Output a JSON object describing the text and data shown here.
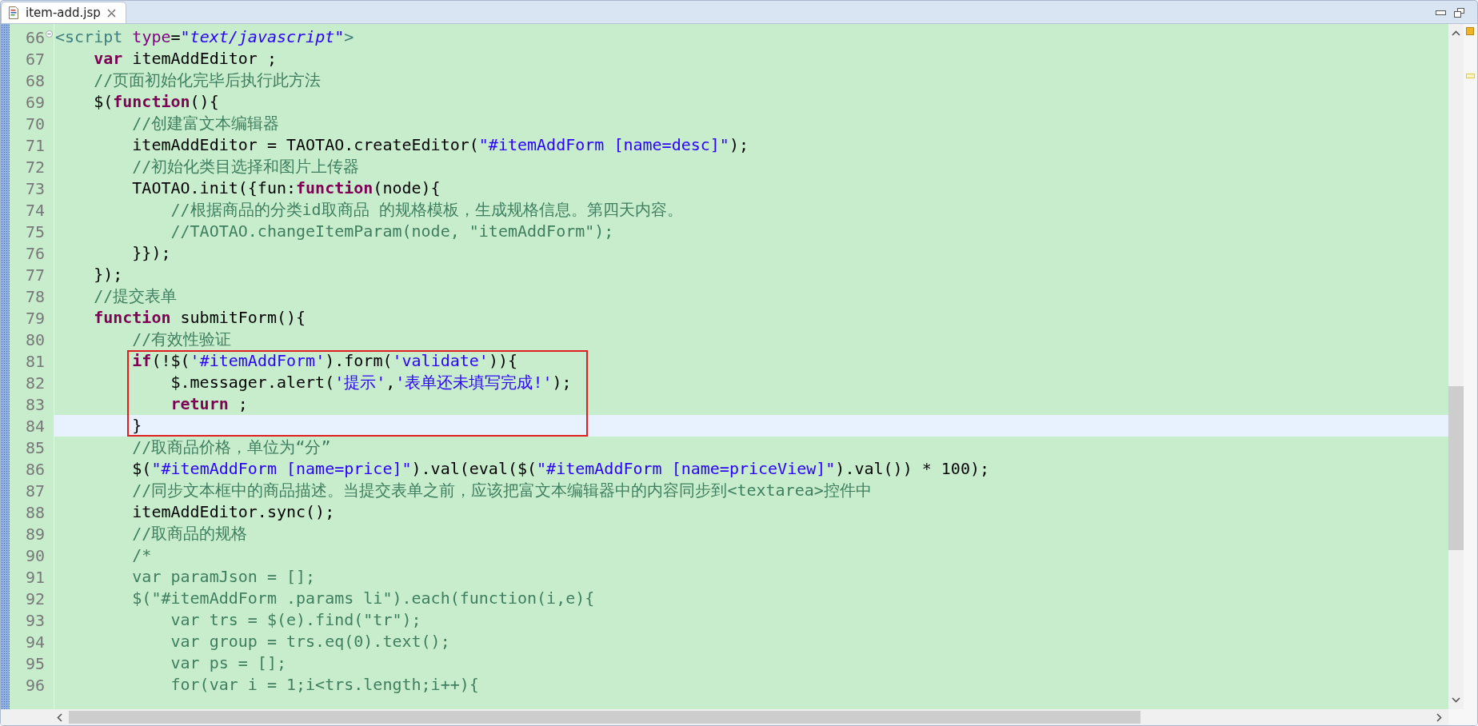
{
  "editor_tab": {
    "title": "item-add.jsp",
    "selected": true
  },
  "lines": [
    {
      "number": "66",
      "fold": true,
      "current": false,
      "boxed": false,
      "tokens": [
        {
          "kind": "tag",
          "text": "<script"
        },
        {
          "kind": "attr",
          "text": " type"
        },
        {
          "kind": "plain",
          "text": "="
        },
        {
          "kind": "attr-value",
          "text": "\"text/javascript\""
        },
        {
          "kind": "tag",
          "text": ">"
        }
      ]
    },
    {
      "number": "67",
      "fold": false,
      "current": false,
      "boxed": false,
      "tokens": [
        {
          "kind": "keyword",
          "text": "    var"
        },
        {
          "kind": "plain",
          "text": " itemAddEditor ;"
        }
      ]
    },
    {
      "number": "68",
      "fold": false,
      "current": false,
      "boxed": false,
      "tokens": [
        {
          "kind": "comment",
          "text": "    //页面初始化完毕后执行此方法"
        }
      ]
    },
    {
      "number": "69",
      "fold": false,
      "current": false,
      "boxed": false,
      "tokens": [
        {
          "kind": "plain",
          "text": "    $("
        },
        {
          "kind": "keyword",
          "text": "function"
        },
        {
          "kind": "plain",
          "text": "(){"
        }
      ]
    },
    {
      "number": "70",
      "fold": false,
      "current": false,
      "boxed": false,
      "tokens": [
        {
          "kind": "comment",
          "text": "        //创建富文本编辑器"
        }
      ]
    },
    {
      "number": "71",
      "fold": false,
      "current": false,
      "boxed": false,
      "tokens": [
        {
          "kind": "plain",
          "text": "        itemAddEditor = TAOTAO.createEditor("
        },
        {
          "kind": "string",
          "text": "\"#itemAddForm [name=desc]\""
        },
        {
          "kind": "plain",
          "text": ");"
        }
      ]
    },
    {
      "number": "72",
      "fold": false,
      "current": false,
      "boxed": false,
      "tokens": [
        {
          "kind": "comment",
          "text": "        //初始化类目选择和图片上传器"
        }
      ]
    },
    {
      "number": "73",
      "fold": false,
      "current": false,
      "boxed": false,
      "tokens": [
        {
          "kind": "plain",
          "text": "        TAOTAO.init({fun:"
        },
        {
          "kind": "keyword",
          "text": "function"
        },
        {
          "kind": "plain",
          "text": "(node){"
        }
      ]
    },
    {
      "number": "74",
      "fold": false,
      "current": false,
      "boxed": false,
      "tokens": [
        {
          "kind": "comment",
          "text": "            //根据商品的分类id取商品 的规格模板，生成规格信息。第四天内容。"
        }
      ]
    },
    {
      "number": "75",
      "fold": false,
      "current": false,
      "boxed": false,
      "tokens": [
        {
          "kind": "comment",
          "text": "            //TAOTAO.changeItemParam(node, \"itemAddForm\");"
        }
      ]
    },
    {
      "number": "76",
      "fold": false,
      "current": false,
      "boxed": false,
      "tokens": [
        {
          "kind": "plain",
          "text": "        }});"
        }
      ]
    },
    {
      "number": "77",
      "fold": false,
      "current": false,
      "boxed": false,
      "tokens": [
        {
          "kind": "plain",
          "text": "    });"
        }
      ]
    },
    {
      "number": "78",
      "fold": false,
      "current": false,
      "boxed": false,
      "tokens": [
        {
          "kind": "comment",
          "text": "    //提交表单"
        }
      ]
    },
    {
      "number": "79",
      "fold": false,
      "current": false,
      "boxed": false,
      "tokens": [
        {
          "kind": "keyword",
          "text": "    function"
        },
        {
          "kind": "plain",
          "text": " submitForm(){"
        }
      ]
    },
    {
      "number": "80",
      "fold": false,
      "current": false,
      "boxed": false,
      "tokens": [
        {
          "kind": "comment",
          "text": "        //有效性验证"
        }
      ]
    },
    {
      "number": "81",
      "fold": false,
      "current": false,
      "boxed": true,
      "tokens": [
        {
          "kind": "keyword",
          "text": "        if"
        },
        {
          "kind": "plain",
          "text": "(!$("
        },
        {
          "kind": "string",
          "text": "'#itemAddForm'"
        },
        {
          "kind": "plain",
          "text": ").form("
        },
        {
          "kind": "string",
          "text": "'validate'"
        },
        {
          "kind": "plain",
          "text": ")){"
        }
      ]
    },
    {
      "number": "82",
      "fold": false,
      "current": false,
      "boxed": true,
      "tokens": [
        {
          "kind": "plain",
          "text": "            $.messager.alert("
        },
        {
          "kind": "string",
          "text": "'提示'"
        },
        {
          "kind": "plain",
          "text": ","
        },
        {
          "kind": "string",
          "text": "'表单还未填写完成!'"
        },
        {
          "kind": "plain",
          "text": ");"
        }
      ]
    },
    {
      "number": "83",
      "fold": false,
      "current": false,
      "boxed": true,
      "tokens": [
        {
          "kind": "keyword",
          "text": "            return"
        },
        {
          "kind": "plain",
          "text": " ;"
        }
      ]
    },
    {
      "number": "84",
      "fold": false,
      "current": true,
      "boxed": true,
      "tokens": [
        {
          "kind": "plain",
          "text": "        }"
        }
      ]
    },
    {
      "number": "85",
      "fold": false,
      "current": false,
      "boxed": false,
      "tokens": [
        {
          "kind": "comment",
          "text": "        //取商品价格，单位为“分”"
        }
      ]
    },
    {
      "number": "86",
      "fold": false,
      "current": false,
      "boxed": false,
      "tokens": [
        {
          "kind": "plain",
          "text": "        $("
        },
        {
          "kind": "string",
          "text": "\"#itemAddForm [name=price]\""
        },
        {
          "kind": "plain",
          "text": ").val(eval($("
        },
        {
          "kind": "string",
          "text": "\"#itemAddForm [name=priceView]\""
        },
        {
          "kind": "plain",
          "text": ").val()) * 100);"
        }
      ]
    },
    {
      "number": "87",
      "fold": false,
      "current": false,
      "boxed": false,
      "tokens": [
        {
          "kind": "comment",
          "text": "        //同步文本框中的商品描述。当提交表单之前，应该把富文本编辑器中的内容同步到<textarea>控件中"
        }
      ]
    },
    {
      "number": "88",
      "fold": false,
      "current": false,
      "boxed": false,
      "tokens": [
        {
          "kind": "plain",
          "text": "        itemAddEditor.sync();"
        }
      ]
    },
    {
      "number": "89",
      "fold": false,
      "current": false,
      "boxed": false,
      "tokens": [
        {
          "kind": "comment",
          "text": "        //取商品的规格"
        }
      ]
    },
    {
      "number": "90",
      "fold": false,
      "current": false,
      "boxed": false,
      "tokens": [
        {
          "kind": "comment",
          "text": "        /*"
        }
      ]
    },
    {
      "number": "91",
      "fold": false,
      "current": false,
      "boxed": false,
      "tokens": [
        {
          "kind": "comment",
          "text": "        var paramJson = [];"
        }
      ]
    },
    {
      "number": "92",
      "fold": false,
      "current": false,
      "boxed": false,
      "tokens": [
        {
          "kind": "comment",
          "text": "        $(\"#itemAddForm .params li\").each(function(i,e){"
        }
      ]
    },
    {
      "number": "93",
      "fold": false,
      "current": false,
      "boxed": false,
      "tokens": [
        {
          "kind": "comment",
          "text": "            var trs = $(e).find(\"tr\");"
        }
      ]
    },
    {
      "number": "94",
      "fold": false,
      "current": false,
      "boxed": false,
      "tokens": [
        {
          "kind": "comment",
          "text": "            var group = trs.eq(0).text();"
        }
      ]
    },
    {
      "number": "95",
      "fold": false,
      "current": false,
      "boxed": false,
      "tokens": [
        {
          "kind": "comment",
          "text": "            var ps = [];"
        }
      ]
    },
    {
      "number": "96",
      "fold": false,
      "current": false,
      "boxed": false,
      "tokens": [
        {
          "kind": "comment",
          "text": "            for(var i = 1;i<trs.length;i++){"
        }
      ]
    }
  ]
}
